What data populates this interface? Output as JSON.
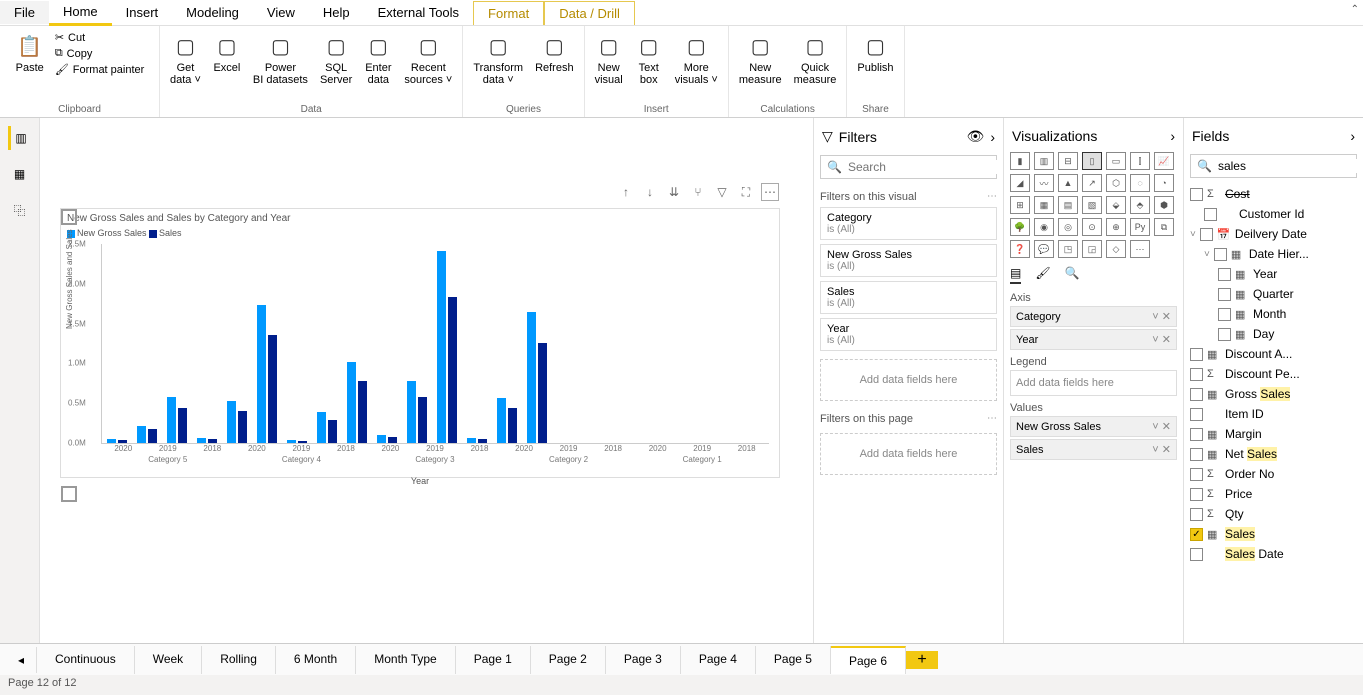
{
  "menu": [
    "File",
    "Home",
    "Insert",
    "Modeling",
    "View",
    "Help",
    "External Tools",
    "Format",
    "Data / Drill"
  ],
  "ribbon": {
    "clipboard": {
      "label": "Clipboard",
      "paste": "Paste",
      "cut": "Cut",
      "copy": "Copy",
      "fp": "Format painter"
    },
    "data": {
      "label": "Data",
      "get": "Get data",
      "excel": "Excel",
      "pbi": "Power BI datasets",
      "sql": "SQL Server",
      "enter": "Enter data",
      "recent": "Recent sources"
    },
    "queries": {
      "label": "Queries",
      "transform": "Transform data",
      "refresh": "Refresh"
    },
    "insert": {
      "label": "Insert",
      "newv": "New visual",
      "text": "Text box",
      "more": "More visuals"
    },
    "calc": {
      "label": "Calculations",
      "newm": "New measure",
      "quick": "Quick measure"
    },
    "share": {
      "label": "Share",
      "publish": "Publish"
    }
  },
  "filters": {
    "title": "Filters",
    "search": "Search",
    "onvisual": "Filters on this visual",
    "cards": [
      {
        "name": "Category",
        "sub": "is (All)"
      },
      {
        "name": "New Gross Sales",
        "sub": "is (All)"
      },
      {
        "name": "Sales",
        "sub": "is (All)"
      },
      {
        "name": "Year",
        "sub": "is (All)"
      }
    ],
    "add": "Add data fields here",
    "onpage": "Filters on this page"
  },
  "viz": {
    "title": "Visualizations",
    "wells": {
      "axis": "Axis",
      "axisItems": [
        "Category",
        "Year"
      ],
      "legend": "Legend",
      "legendEmpty": "Add data fields here",
      "values": "Values",
      "valueItems": [
        "New Gross Sales",
        "Sales"
      ]
    }
  },
  "fields": {
    "title": "Fields",
    "search": "sales",
    "items": [
      {
        "icon": "Σ",
        "label": "Cost",
        "strike": true
      },
      {
        "icon": "",
        "label": "Customer Id",
        "indent": 1
      },
      {
        "icon": "📅",
        "label": "Deilvery Date",
        "chev": true
      },
      {
        "icon": "▦",
        "label": "Date Hier...",
        "indent": 1,
        "chev": true
      },
      {
        "icon": "▦",
        "label": "Year",
        "indent": 2
      },
      {
        "icon": "▦",
        "label": "Quarter",
        "indent": 2
      },
      {
        "icon": "▦",
        "label": "Month",
        "indent": 2
      },
      {
        "icon": "▦",
        "label": "Day",
        "indent": 2
      },
      {
        "icon": "▦",
        "label": "Discount A..."
      },
      {
        "icon": "Σ",
        "label": "Discount Pe..."
      },
      {
        "icon": "▦",
        "label": "Gross ",
        "hl": "Sales"
      },
      {
        "icon": "",
        "label": "Item ID"
      },
      {
        "icon": "▦",
        "label": "Margin"
      },
      {
        "icon": "▦",
        "label": "Net ",
        "hl": "Sales"
      },
      {
        "icon": "Σ",
        "label": "Order No"
      },
      {
        "icon": "Σ",
        "label": "Price"
      },
      {
        "icon": "Σ",
        "label": "Qty"
      },
      {
        "icon": "▦",
        "label": "",
        "hl": "Sales",
        "checked": true
      },
      {
        "icon": "",
        "label": "",
        "hl": "Sales",
        "suffix": " Date"
      }
    ]
  },
  "tabs": [
    "Continuous",
    "Week",
    "Rolling",
    "6 Month",
    "Month Type",
    "Page 1",
    "Page 2",
    "Page 3",
    "Page 4",
    "Page 5",
    "Page 6"
  ],
  "status": "Page 12 of 12",
  "chart_data": {
    "type": "bar",
    "title": "New Gross Sales and Sales by Category and Year",
    "ylabel": "New Gross Sales and Sales",
    "xlabel": "Year",
    "legend": [
      "New Gross Sales",
      "Sales"
    ],
    "colors": [
      "#0099ff",
      "#001e8c"
    ],
    "yticks": [
      "0.0M",
      "0.5M",
      "1.0M",
      "1.5M",
      "2.0M",
      "2.5M"
    ],
    "ymax": 2.6,
    "categories": [
      "Category 5",
      "Category 4",
      "Category 3",
      "Category 2",
      "Category 1"
    ],
    "years": [
      "2020",
      "2019",
      "2018"
    ],
    "series": [
      {
        "name": "New Gross Sales",
        "values": {
          "Category 5": {
            "2020": 0.05,
            "2019": 0.22,
            "2018": 0.6
          },
          "Category 4": {
            "2020": 0.07,
            "2019": 0.55,
            "2018": 1.8
          },
          "Category 3": {
            "2020": 0.04,
            "2019": 0.4,
            "2018": 1.05
          },
          "Category 2": {
            "2020": 0.1,
            "2019": 0.8,
            "2018": 2.5
          },
          "Category 1": {
            "2020": 0.07,
            "2019": 0.58,
            "2018": 1.7
          }
        }
      },
      {
        "name": "Sales",
        "values": {
          "Category 5": {
            "2020": 0.04,
            "2019": 0.18,
            "2018": 0.45
          },
          "Category 4": {
            "2020": 0.05,
            "2019": 0.42,
            "2018": 1.4
          },
          "Category 3": {
            "2020": 0.03,
            "2019": 0.3,
            "2018": 0.8
          },
          "Category 2": {
            "2020": 0.08,
            "2019": 0.6,
            "2018": 1.9
          },
          "Category 1": {
            "2020": 0.05,
            "2019": 0.45,
            "2018": 1.3
          }
        }
      }
    ]
  }
}
